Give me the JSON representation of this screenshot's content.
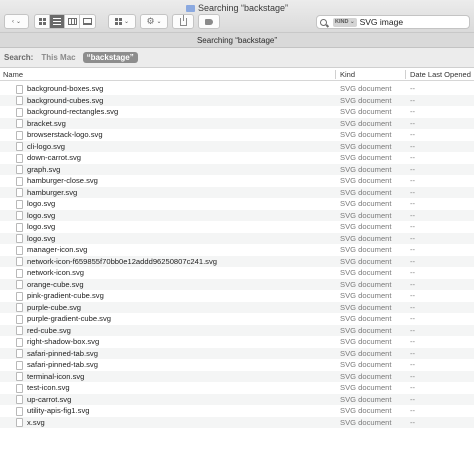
{
  "window": {
    "title": "Searching “backstage”"
  },
  "path_title": "Searching “backstage”",
  "search": {
    "token": "KIND ⌄",
    "query": "SVG image"
  },
  "scope": {
    "label": "Search:",
    "options": [
      "This Mac",
      "“backstage”"
    ],
    "active_index": 1
  },
  "columns": {
    "name": "Name",
    "kind": "Kind",
    "date": "Date Last Opened"
  },
  "files": [
    {
      "name": "background-boxes.svg",
      "kind": "SVG document",
      "date": "--"
    },
    {
      "name": "background-cubes.svg",
      "kind": "SVG document",
      "date": "--"
    },
    {
      "name": "background-rectangles.svg",
      "kind": "SVG document",
      "date": "--"
    },
    {
      "name": "bracket.svg",
      "kind": "SVG document",
      "date": "--"
    },
    {
      "name": "browserstack-logo.svg",
      "kind": "SVG document",
      "date": "--"
    },
    {
      "name": "cli-logo.svg",
      "kind": "SVG document",
      "date": "--"
    },
    {
      "name": "down-carrot.svg",
      "kind": "SVG document",
      "date": "--"
    },
    {
      "name": "graph.svg",
      "kind": "SVG document",
      "date": "--"
    },
    {
      "name": "hamburger-close.svg",
      "kind": "SVG document",
      "date": "--"
    },
    {
      "name": "hamburger.svg",
      "kind": "SVG document",
      "date": "--"
    },
    {
      "name": "logo.svg",
      "kind": "SVG document",
      "date": "--"
    },
    {
      "name": "logo.svg",
      "kind": "SVG document",
      "date": "--"
    },
    {
      "name": "logo.svg",
      "kind": "SVG document",
      "date": "--"
    },
    {
      "name": "logo.svg",
      "kind": "SVG document",
      "date": "--"
    },
    {
      "name": "manager-icon.svg",
      "kind": "SVG document",
      "date": "--"
    },
    {
      "name": "network-icon-f659855f70bb0e12addd96250807c241.svg",
      "kind": "SVG document",
      "date": "--"
    },
    {
      "name": "network-icon.svg",
      "kind": "SVG document",
      "date": "--"
    },
    {
      "name": "orange-cube.svg",
      "kind": "SVG document",
      "date": "--"
    },
    {
      "name": "pink-gradient-cube.svg",
      "kind": "SVG document",
      "date": "--"
    },
    {
      "name": "purple-cube.svg",
      "kind": "SVG document",
      "date": "--"
    },
    {
      "name": "purple-gradient-cube.svg",
      "kind": "SVG document",
      "date": "--"
    },
    {
      "name": "red-cube.svg",
      "kind": "SVG document",
      "date": "--"
    },
    {
      "name": "right-shadow-box.svg",
      "kind": "SVG document",
      "date": "--"
    },
    {
      "name": "safari-pinned-tab.svg",
      "kind": "SVG document",
      "date": "--"
    },
    {
      "name": "safari-pinned-tab.svg",
      "kind": "SVG document",
      "date": "--"
    },
    {
      "name": "terminal-icon.svg",
      "kind": "SVG document",
      "date": "--"
    },
    {
      "name": "test-icon.svg",
      "kind": "SVG document",
      "date": "--"
    },
    {
      "name": "up-carrot.svg",
      "kind": "SVG document",
      "date": "--"
    },
    {
      "name": "utility-apis-fig1.svg",
      "kind": "SVG document",
      "date": "--"
    },
    {
      "name": "x.svg",
      "kind": "SVG document",
      "date": "--"
    }
  ],
  "colors": {
    "toolbar": "#dadada",
    "scope_active": "#8d8d8d",
    "row_alt": "#f4f5f5"
  },
  "icons": [
    "back-icon",
    "view-icons-icon",
    "view-list-icon",
    "view-columns-icon",
    "view-gallery-icon",
    "group-icon",
    "action-gear-icon",
    "share-icon",
    "tag-icon",
    "search-icon",
    "file-icon"
  ]
}
